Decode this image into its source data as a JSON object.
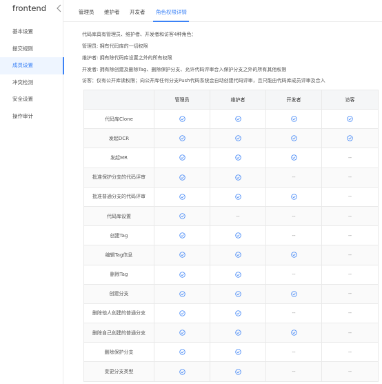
{
  "sidebar": {
    "repo_name": "frontend",
    "items": [
      {
        "label": "基本设置"
      },
      {
        "label": "提交规则"
      },
      {
        "label": "成员设置"
      },
      {
        "label": "冲突检测"
      },
      {
        "label": "安全设置"
      },
      {
        "label": "操作审计"
      }
    ],
    "active_index": 2
  },
  "tabs": [
    {
      "label": "管理员"
    },
    {
      "label": "维护者"
    },
    {
      "label": "开发者"
    },
    {
      "label": "角色权限详情"
    }
  ],
  "active_tab": 3,
  "description": [
    "代码库具有管理员、维护者、开发者和访客4种角色：",
    "管理员: 拥有代码库的一切权限",
    "维护者: 拥有除代码库设置之外的所有权限",
    "开发者: 拥有除创建及删除Tag、删除保护分支、允许代码评审合入保护分支之外的所有其他权限",
    "访客：仅有公开库读权限；向公开库任何分支Push代码系统会自动创建代码评审，且只能由代码库成员评审及合入"
  ],
  "table": {
    "columns": [
      "",
      "管理员",
      "维护者",
      "开发者",
      "访客"
    ],
    "rows": [
      {
        "label": "代码库Clone",
        "cells": [
          "check",
          "check",
          "check",
          "check"
        ]
      },
      {
        "label": "发起DCR",
        "cells": [
          "check",
          "check",
          "check",
          "check"
        ]
      },
      {
        "label": "发起MR",
        "cells": [
          "check",
          "check",
          "check",
          "--"
        ]
      },
      {
        "label": "批准保护分支的代码评审",
        "cells": [
          "check",
          "check",
          "--",
          "--"
        ]
      },
      {
        "label": "批准普通分支的代码评审",
        "cells": [
          "check",
          "check",
          "check",
          "--"
        ]
      },
      {
        "label": "代码库设置",
        "cells": [
          "check",
          "--",
          "--",
          "--"
        ]
      },
      {
        "label": "创建Tag",
        "cells": [
          "check",
          "check",
          "--",
          "--"
        ]
      },
      {
        "label": "编辑Tag信息",
        "cells": [
          "check",
          "check",
          "check",
          "--"
        ]
      },
      {
        "label": "删除Tag",
        "cells": [
          "check",
          "check",
          "--",
          "--"
        ]
      },
      {
        "label": "创建分支",
        "cells": [
          "check",
          "check",
          "check",
          "--"
        ]
      },
      {
        "label": "删除他人创建的普通分支",
        "cells": [
          "check",
          "check",
          "--",
          "--"
        ]
      },
      {
        "label": "删除自己创建的普通分支",
        "cells": [
          "check",
          "check",
          "check",
          "--"
        ]
      },
      {
        "label": "删除保护分支",
        "cells": [
          "check",
          "check",
          "--",
          "--"
        ]
      },
      {
        "label": "变更分支类型",
        "cells": [
          "check",
          "check",
          "--",
          "--"
        ]
      }
    ]
  },
  "colors": {
    "accent": "#3b82f6",
    "active_bg": "#eef5ff",
    "header_bg": "#f5f6f7"
  },
  "icons": {
    "check": "check-circle-icon",
    "collapse": "chevron-left-icon"
  }
}
